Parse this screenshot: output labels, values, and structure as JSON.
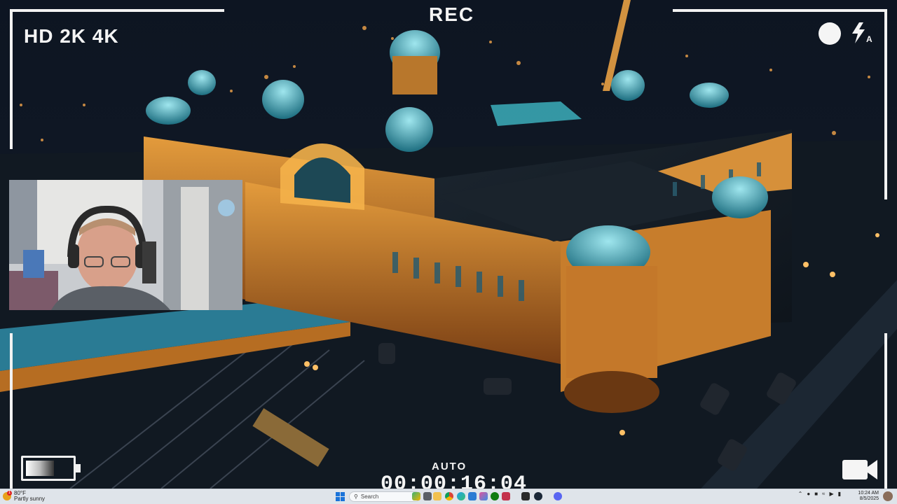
{
  "overlay": {
    "quality_label": "HD 2K 4K",
    "rec_label": "REC",
    "mode_label": "AUTO",
    "timecode": "00:00:16:04"
  },
  "icons": {
    "record_dot": "record-dot-icon",
    "flash_auto": "flash-auto-icon",
    "battery": "battery-icon",
    "video_camera": "video-camera-icon"
  },
  "colors": {
    "hud": "#f2f2f2",
    "building_light": "#f0a23a",
    "dome_teal": "#3fb8c4",
    "taskbar_bg": "#dfe4ea"
  },
  "taskbar": {
    "weather_temp": "80°F",
    "weather_desc": "Partly sunny",
    "weather_badge": "1",
    "search_placeholder": "Search",
    "time": "10:24 AM",
    "date": "8/5/2025",
    "apps": [
      "file-explorer",
      "edge",
      "chrome",
      "mail",
      "photos",
      "xbox",
      "epic-games",
      "steam",
      "discord"
    ]
  }
}
